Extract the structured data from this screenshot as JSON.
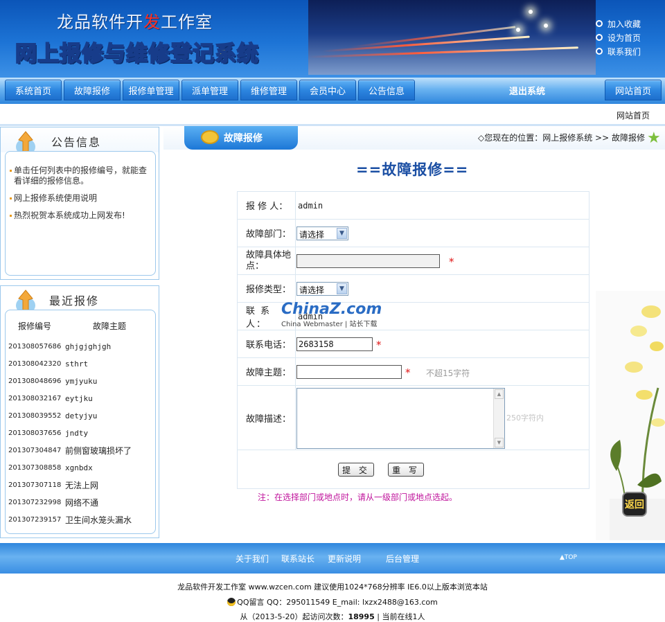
{
  "header": {
    "studio_a": "龙品软件开",
    "studio_b": "发",
    "studio_c": "工作室",
    "system_name": "网上报修与维修登记系统",
    "top_links": [
      "加入收藏",
      "设为首页",
      "联系我们"
    ]
  },
  "nav": {
    "items": [
      "系统首页",
      "故障报修",
      "报修单管理",
      "派单管理",
      "维修管理",
      "会员中心",
      "公告信息"
    ],
    "logout": "退出系统",
    "site_home": "网站首页"
  },
  "subbar": {
    "home": "网站首页"
  },
  "notices_panel": {
    "title": "公告信息",
    "items": [
      "单击任何列表中的报修编号，就能查看详细的报修信息。",
      "网上报修系统使用说明",
      "热烈祝贺本系统成功上网发布!"
    ]
  },
  "recent_panel": {
    "title": "最近报修",
    "col_id": "报修编号",
    "col_subject": "故障主题",
    "rows": [
      {
        "id": "201308057686",
        "subject": "ghjgjghjgh"
      },
      {
        "id": "201308042320",
        "subject": "sthrt"
      },
      {
        "id": "201308048696",
        "subject": "ymjyuku"
      },
      {
        "id": "201308032167",
        "subject": "eytjku"
      },
      {
        "id": "201308039552",
        "subject": "detyjyu"
      },
      {
        "id": "201308037656",
        "subject": "jndty"
      },
      {
        "id": "201307304847",
        "subject": "前侧窗玻璃损坏了"
      },
      {
        "id": "201307308858",
        "subject": "xgnbdx"
      },
      {
        "id": "201307307118",
        "subject": "无法上网"
      },
      {
        "id": "201307232998",
        "subject": "网络不通"
      },
      {
        "id": "201307239157",
        "subject": "卫生间水笼头漏水"
      }
    ]
  },
  "page": {
    "tab": "故障报修",
    "breadcrumb": "◇您现在的位置：网上报修系统 >> 故障报修",
    "form_title": "==故障报修=="
  },
  "form": {
    "reporter_label": "报 修 人：",
    "reporter_value": "admin",
    "dept_label": "故障部门：",
    "dept_value": "请选择",
    "location_label": "故障具体地　点：",
    "location_value": "",
    "type_label": "报修类型：",
    "type_value": "请选择",
    "contact_label": "联 系 人：",
    "contact_value": "admin",
    "phone_label": "联系电话：",
    "phone_value": "2683158",
    "subject_label": "故障主题：",
    "subject_value": "",
    "subject_hint": "不超15字符",
    "desc_label": "故障描述：",
    "desc_hint": "250字符内",
    "required_mark": "*",
    "submit": "提 交",
    "reset": "重 写",
    "note": "注：在选择部门或地点时，请从一级部门或地点选起。"
  },
  "watermark": {
    "brand": "ChinaZ.com",
    "sub": "China Webmaster | 站长下载"
  },
  "back_button": "返回",
  "footer": {
    "links": [
      "关于我们",
      "联系站长",
      "更新说明",
      "后台管理"
    ],
    "top": "▲TOP",
    "line1": "龙品软件开发工作室 www.wzcen.com 建议使用1024*768分辨率 IE6.0以上版本浏览本站",
    "line2": "QQ留言 QQ：295011549   E_mail: lxzx2488@163.com",
    "line3_pre": "从（2013-5-20）起访问次数：",
    "visits": "18995",
    "line3_post": " | 当前在线1人"
  },
  "colors": {
    "primary_blue": "#1d74d6",
    "title_blue": "#1a4ea3",
    "required_red": "#e01616",
    "note_magenta": "#c0159c"
  }
}
